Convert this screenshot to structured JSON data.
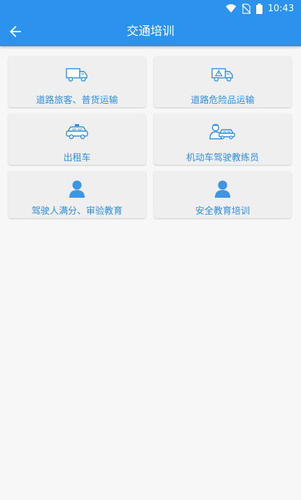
{
  "status_bar": {
    "time": "10:43"
  },
  "app_bar": {
    "title": "交通培训"
  },
  "cards": [
    {
      "label": "道路旅客、普货运输",
      "icon": "truck-icon"
    },
    {
      "label": "道路危险品运输",
      "icon": "hazmat-truck-icon"
    },
    {
      "label": "出租车",
      "icon": "taxi-icon"
    },
    {
      "label": "机动车驾驶教练员",
      "icon": "driving-instructor-icon"
    },
    {
      "label": "驾驶人满分、审验教育",
      "icon": "user-icon"
    },
    {
      "label": "安全教育培训",
      "icon": "user-icon"
    }
  ],
  "colors": {
    "primary": "#2b93ee",
    "label": "#2f8ee0",
    "card": "#efefef",
    "background": "#f7f7f7"
  }
}
